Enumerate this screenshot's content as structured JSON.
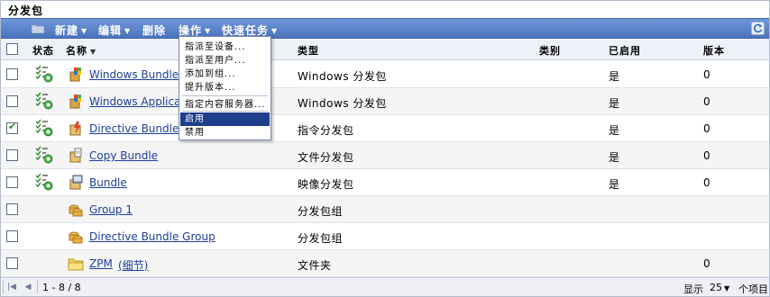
{
  "panel": {
    "title": "分发包"
  },
  "toolbar": {
    "new_label": "新建",
    "edit_label": "编辑",
    "delete_label": "删除",
    "actions_label": "操作",
    "quick_tasks_label": "快速任务"
  },
  "columns": {
    "status": "状态",
    "name": "名称",
    "type": "类型",
    "category": "类别",
    "enabled": "已启用",
    "version": "版本"
  },
  "rows": [
    {
      "checked": false,
      "has_status": true,
      "icon": "windows-bundle-icon",
      "name": "Windows Bundle",
      "type": "Windows 分发包",
      "category": "",
      "enabled": "是",
      "version": "0"
    },
    {
      "checked": false,
      "has_status": true,
      "icon": "windows-bundle-icon",
      "name": "Windows Applica",
      "type": "Windows 分发包",
      "category": "",
      "enabled": "是",
      "version": "0"
    },
    {
      "checked": true,
      "has_status": true,
      "icon": "directive-bundle-icon",
      "name": "Directive Bundle",
      "type": "指令分发包",
      "category": "",
      "enabled": "是",
      "version": "0"
    },
    {
      "checked": false,
      "has_status": true,
      "icon": "file-bundle-icon",
      "name": "Copy Bundle",
      "type": "文件分发包",
      "category": "",
      "enabled": "是",
      "version": "0"
    },
    {
      "checked": false,
      "has_status": true,
      "icon": "image-bundle-icon",
      "name": "Bundle",
      "type": "映像分发包",
      "category": "",
      "enabled": "是",
      "version": "0"
    },
    {
      "checked": false,
      "has_status": false,
      "icon": "bundle-group-icon",
      "name": "Group 1",
      "type": "分发包组",
      "category": "",
      "enabled": "",
      "version": ""
    },
    {
      "checked": false,
      "has_status": false,
      "icon": "bundle-group-icon",
      "name": "Directive Bundle Group",
      "type": "分发包组",
      "category": "",
      "enabled": "",
      "version": ""
    },
    {
      "checked": false,
      "has_status": false,
      "icon": "folder-icon",
      "name": "ZPM",
      "name_suffix": "(细节)",
      "type": "文件夹",
      "category": "",
      "enabled": "",
      "version": "0"
    }
  ],
  "actions_menu": {
    "items": [
      "指派至设备...",
      "指派至用户...",
      "添加到组...",
      "提升版本...",
      "指定内容服务器...",
      "启用",
      "禁用"
    ],
    "selected_index": 5
  },
  "footer": {
    "range": "1 - 8 / 8",
    "show_label": "显示",
    "per_page": "25",
    "items_label": "个项目"
  },
  "colors": {
    "toolbar": "#4a73bd",
    "link": "#1d3f9a",
    "menu_selected": "#1f3e8c"
  }
}
